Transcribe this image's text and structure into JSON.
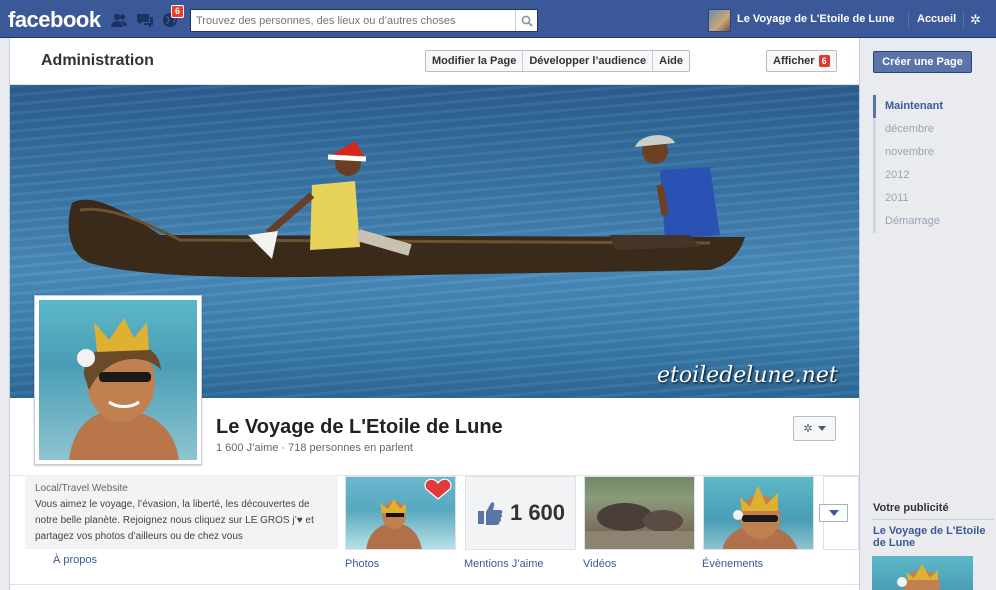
{
  "topbar": {
    "logo": "facebook",
    "search_placeholder": "Trouvez des personnes, des lieux ou d’autres choses",
    "notifications_count": "6",
    "user_name": "Le Voyage de L'Etoile de Lune",
    "home_label": "Accueil"
  },
  "admin": {
    "title": "Administration",
    "edit_page_label": "Modifier la Page",
    "grow_audience_label": "Développer l’audience",
    "help_label": "Aide",
    "show_label": "Afficher",
    "show_badge": "6"
  },
  "cover": {
    "watermark": "etoiledelune.net"
  },
  "page": {
    "name": "Le Voyage de L'Etoile de Lune",
    "stats": "1 600 J’aime · 718 personnes en parlent"
  },
  "info": {
    "category": "Local/Travel Website",
    "description": "Vous aimez le voyage, l’évasion, la liberté, les découvertes de notre belle planète. Rejoignez nous cliquez sur LE GROS j’♥ et partagez vos photos d’ailleurs ou de chez vous",
    "about_label": "À propos"
  },
  "tiles": [
    {
      "label": "Photos"
    },
    {
      "label": "Mentions J’aime",
      "value": "1 600"
    },
    {
      "label": "Vidéos"
    },
    {
      "label": "Évènements"
    }
  ],
  "sidebar": {
    "create_page_label": "Créer une Page",
    "timeline": [
      "Maintenant",
      "décembre",
      "novembre",
      "2012",
      "2011",
      "Démarrage"
    ],
    "ads_title": "Votre publicité",
    "ad_name": "Le Voyage de L'Etoile de Lune"
  },
  "colors": {
    "brand": "#3b5998",
    "badge": "#f03d25"
  }
}
